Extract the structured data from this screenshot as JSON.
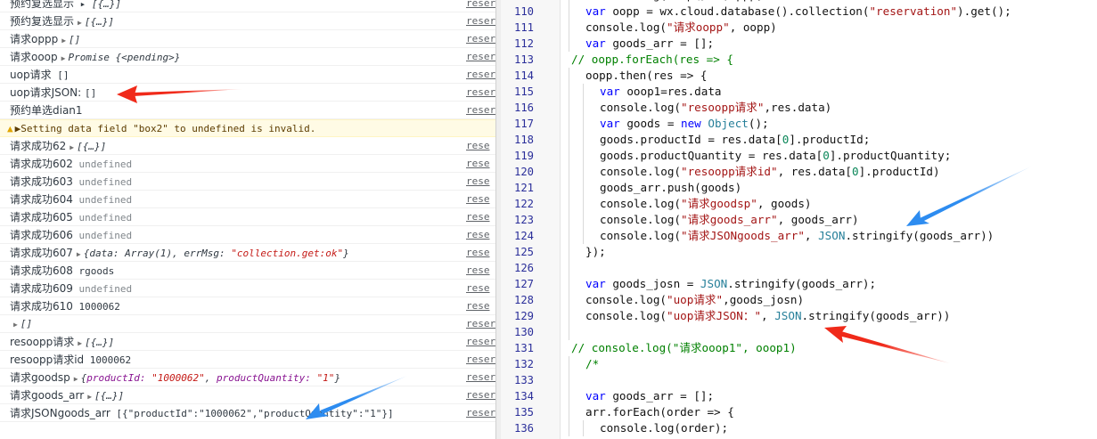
{
  "console": {
    "rows": [
      {
        "kind": "plain",
        "parts": [
          {
            "t": "cjk",
            "v": "预约复选显示"
          },
          {
            "t": "obj",
            "v": " ▸ [{…}]"
          }
        ],
        "src": "reser"
      },
      {
        "kind": "plain",
        "parts": [
          {
            "t": "cjk",
            "v": "预约复选显示"
          },
          {
            "t": "tri",
            "v": "▶"
          },
          {
            "t": "obj",
            "v": "[{…}]"
          }
        ],
        "src": "reser"
      },
      {
        "kind": "plain",
        "parts": [
          {
            "t": "cjk",
            "v": "请求oppp"
          },
          {
            "t": "tri",
            "v": "▶"
          },
          {
            "t": "obj",
            "v": "[]"
          }
        ],
        "src": "reserv"
      },
      {
        "kind": "plain",
        "parts": [
          {
            "t": "cjk",
            "v": "请求ooop"
          },
          {
            "t": "tri",
            "v": "▶"
          },
          {
            "t": "obj",
            "v": "Promise {<pending>}"
          }
        ],
        "src": "reserv"
      },
      {
        "kind": "plain",
        "parts": [
          {
            "t": "cjk",
            "v": "uop请求"
          },
          {
            "t": "txt",
            "v": " []"
          }
        ],
        "src": "reserv"
      },
      {
        "kind": "plain",
        "parts": [
          {
            "t": "cjk",
            "v": "uop请求JSON: "
          },
          {
            "t": "txt",
            "v": " []"
          }
        ],
        "src": "reserv"
      },
      {
        "kind": "plain",
        "parts": [
          {
            "t": "cjk",
            "v": "预约单选dian1"
          }
        ],
        "src": "reser"
      },
      {
        "kind": "warn",
        "parts": [
          {
            "t": "txt",
            "v": "▶Setting data field \"box2\" to undefined is invalid."
          }
        ],
        "src": ""
      },
      {
        "kind": "plain",
        "parts": [
          {
            "t": "cjk",
            "v": "请求成功62"
          },
          {
            "t": "tri",
            "v": "▶"
          },
          {
            "t": "obj",
            "v": "[{…}]"
          }
        ],
        "src": "rese"
      },
      {
        "kind": "plain",
        "parts": [
          {
            "t": "cjk",
            "v": "请求成功602"
          },
          {
            "t": "undef",
            "v": " undefined"
          }
        ],
        "src": "rese"
      },
      {
        "kind": "plain",
        "parts": [
          {
            "t": "cjk",
            "v": "请求成功603"
          },
          {
            "t": "undef",
            "v": " undefined"
          }
        ],
        "src": "rese"
      },
      {
        "kind": "plain",
        "parts": [
          {
            "t": "cjk",
            "v": "请求成功604"
          },
          {
            "t": "undef",
            "v": " undefined"
          }
        ],
        "src": "rese"
      },
      {
        "kind": "plain",
        "parts": [
          {
            "t": "cjk",
            "v": "请求成功605"
          },
          {
            "t": "undef",
            "v": " undefined"
          }
        ],
        "src": "rese"
      },
      {
        "kind": "plain",
        "parts": [
          {
            "t": "cjk",
            "v": "请求成功606"
          },
          {
            "t": "undef",
            "v": " undefined"
          }
        ],
        "src": "rese"
      },
      {
        "kind": "plain",
        "parts": [
          {
            "t": "cjk",
            "v": "请求成功607"
          },
          {
            "t": "tri",
            "v": "▶"
          },
          {
            "t": "obj",
            "v": "{data: Array(1), errMsg: "
          },
          {
            "t": "str",
            "v": "\"collection.get:ok\""
          },
          {
            "t": "obj",
            "v": "}"
          }
        ],
        "src": "rese"
      },
      {
        "kind": "plain",
        "parts": [
          {
            "t": "cjk",
            "v": "请求成功608"
          },
          {
            "t": "txt",
            "v": " rgoods"
          }
        ],
        "src": "rese"
      },
      {
        "kind": "plain",
        "parts": [
          {
            "t": "cjk",
            "v": "请求成功609"
          },
          {
            "t": "undef",
            "v": " undefined"
          }
        ],
        "src": "rese"
      },
      {
        "kind": "plain",
        "parts": [
          {
            "t": "cjk",
            "v": "请求成功610"
          },
          {
            "t": "txt",
            "v": " 1000062"
          }
        ],
        "src": "rese"
      },
      {
        "kind": "plain",
        "parts": [
          {
            "t": "tri",
            "v": "▶"
          },
          {
            "t": "obj",
            "v": "[]"
          }
        ],
        "src": "reser"
      },
      {
        "kind": "plain",
        "parts": [
          {
            "t": "cjk",
            "v": "resoopp请求"
          },
          {
            "t": "tri",
            "v": "▶"
          },
          {
            "t": "obj",
            "v": "[{…}]"
          }
        ],
        "src": "reser"
      },
      {
        "kind": "plain",
        "parts": [
          {
            "t": "cjk",
            "v": "resoopp请求id"
          },
          {
            "t": "txt",
            "v": " 1000062"
          }
        ],
        "src": "reser"
      },
      {
        "kind": "plain",
        "parts": [
          {
            "t": "cjk",
            "v": "请求goodsp"
          },
          {
            "t": "tri",
            "v": "▶"
          },
          {
            "t": "obj",
            "v": "{"
          },
          {
            "t": "key",
            "v": "productId: "
          },
          {
            "t": "str",
            "v": "\"1000062\""
          },
          {
            "t": "obj",
            "v": ", "
          },
          {
            "t": "key",
            "v": "productQuantity: "
          },
          {
            "t": "str",
            "v": "\"1\""
          },
          {
            "t": "obj",
            "v": "}"
          }
        ],
        "src": "reser"
      },
      {
        "kind": "plain",
        "parts": [
          {
            "t": "cjk",
            "v": "请求goods_arr"
          },
          {
            "t": "tri",
            "v": "▶"
          },
          {
            "t": "obj",
            "v": "[{…}]"
          }
        ],
        "src": "reser"
      },
      {
        "kind": "plain",
        "parts": [
          {
            "t": "cjk",
            "v": "请求JSONgoods_arr"
          },
          {
            "t": "txt",
            "v": " [{\"productId\":\"1000062\",\"productQuantity\":\"1\"}]"
          }
        ],
        "src": "reser"
      }
    ]
  },
  "editor": {
    "lines": [
      {
        "n": "",
        "indent": 1,
        "tokens": [
          {
            "c": "t-pl",
            "v": "console.log(\"uop请求\",oppp)"
          }
        ]
      },
      {
        "n": "110",
        "indent": 1,
        "tokens": [
          {
            "c": "t-kw",
            "v": "var "
          },
          {
            "c": "t-pl",
            "v": "oopp = wx.cloud.database().collection("
          },
          {
            "c": "t-str",
            "v": "\"reservation\""
          },
          {
            "c": "t-pl",
            "v": ").get();"
          }
        ]
      },
      {
        "n": "111",
        "indent": 1,
        "tokens": [
          {
            "c": "t-pl",
            "v": "console.log("
          },
          {
            "c": "t-str",
            "v": "\"请求oopp\""
          },
          {
            "c": "t-pl",
            "v": ", oopp)"
          }
        ]
      },
      {
        "n": "112",
        "indent": 1,
        "tokens": [
          {
            "c": "t-kw",
            "v": "var "
          },
          {
            "c": "t-pl",
            "v": "goods_arr = [];"
          }
        ]
      },
      {
        "n": "113",
        "indent": 0,
        "tokens": [
          {
            "c": "t-cm",
            "v": "// oopp.forEach(res => {"
          }
        ]
      },
      {
        "n": "114",
        "indent": 1,
        "tokens": [
          {
            "c": "t-pl",
            "v": "oopp.then(res => {"
          }
        ]
      },
      {
        "n": "115",
        "indent": 2,
        "tokens": [
          {
            "c": "t-kw",
            "v": "var "
          },
          {
            "c": "t-pl",
            "v": "ooop1=res.data"
          }
        ]
      },
      {
        "n": "116",
        "indent": 2,
        "tokens": [
          {
            "c": "t-pl",
            "v": "console.log("
          },
          {
            "c": "t-str",
            "v": "\"resoopp请求\""
          },
          {
            "c": "t-pl",
            "v": ",res.data)"
          }
        ]
      },
      {
        "n": "117",
        "indent": 2,
        "tokens": [
          {
            "c": "t-kw",
            "v": "var "
          },
          {
            "c": "t-pl",
            "v": "goods = "
          },
          {
            "c": "t-kw",
            "v": "new "
          },
          {
            "c": "t-ty",
            "v": "Object"
          },
          {
            "c": "t-pl",
            "v": "();"
          }
        ]
      },
      {
        "n": "118",
        "indent": 2,
        "tokens": [
          {
            "c": "t-pl",
            "v": "goods.productId = res.data["
          },
          {
            "c": "t-num",
            "v": "0"
          },
          {
            "c": "t-pl",
            "v": "].productId;"
          }
        ]
      },
      {
        "n": "119",
        "indent": 2,
        "tokens": [
          {
            "c": "t-pl",
            "v": "goods.productQuantity = res.data["
          },
          {
            "c": "t-num",
            "v": "0"
          },
          {
            "c": "t-pl",
            "v": "].productQuantity;"
          }
        ]
      },
      {
        "n": "120",
        "indent": 2,
        "tokens": [
          {
            "c": "t-pl",
            "v": "console.log("
          },
          {
            "c": "t-str",
            "v": "\"resoopp请求id\""
          },
          {
            "c": "t-pl",
            "v": ", res.data["
          },
          {
            "c": "t-num",
            "v": "0"
          },
          {
            "c": "t-pl",
            "v": "].productId)"
          }
        ]
      },
      {
        "n": "121",
        "indent": 2,
        "tokens": [
          {
            "c": "t-pl",
            "v": "goods_arr.push(goods)"
          }
        ]
      },
      {
        "n": "122",
        "indent": 2,
        "tokens": [
          {
            "c": "t-pl",
            "v": "console.log("
          },
          {
            "c": "t-str",
            "v": "\"请求goodsp\""
          },
          {
            "c": "t-pl",
            "v": ", goods)"
          }
        ]
      },
      {
        "n": "123",
        "indent": 2,
        "tokens": [
          {
            "c": "t-pl",
            "v": "console.log("
          },
          {
            "c": "t-str",
            "v": "\"请求goods_arr\""
          },
          {
            "c": "t-pl",
            "v": ", goods_arr)"
          }
        ]
      },
      {
        "n": "124",
        "indent": 2,
        "tokens": [
          {
            "c": "t-pl",
            "v": "console.log("
          },
          {
            "c": "t-str",
            "v": "\"请求JSONgoods_arr\""
          },
          {
            "c": "t-pl",
            "v": ", "
          },
          {
            "c": "t-ty",
            "v": "JSON"
          },
          {
            "c": "t-pl",
            "v": ".stringify(goods_arr))"
          }
        ]
      },
      {
        "n": "125",
        "indent": 1,
        "tokens": [
          {
            "c": "t-pl",
            "v": "});"
          }
        ]
      },
      {
        "n": "126",
        "indent": 1,
        "tokens": []
      },
      {
        "n": "127",
        "indent": 1,
        "tokens": [
          {
            "c": "t-kw",
            "v": "var "
          },
          {
            "c": "t-pl",
            "v": "goods_josn = "
          },
          {
            "c": "t-ty",
            "v": "JSON"
          },
          {
            "c": "t-pl",
            "v": ".stringify(goods_arr);"
          }
        ]
      },
      {
        "n": "128",
        "indent": 1,
        "tokens": [
          {
            "c": "t-pl",
            "v": "console.log("
          },
          {
            "c": "t-str",
            "v": "\"uop请求\""
          },
          {
            "c": "t-pl",
            "v": ",goods_josn)"
          }
        ]
      },
      {
        "n": "129",
        "indent": 1,
        "tokens": [
          {
            "c": "t-pl",
            "v": "console.log("
          },
          {
            "c": "t-str",
            "v": "\"uop请求JSON：\""
          },
          {
            "c": "t-pl",
            "v": ", "
          },
          {
            "c": "t-ty",
            "v": "JSON"
          },
          {
            "c": "t-pl",
            "v": ".stringify(goods_arr))"
          }
        ]
      },
      {
        "n": "130",
        "indent": 1,
        "tokens": []
      },
      {
        "n": "131",
        "indent": 0,
        "tokens": [
          {
            "c": "t-cm",
            "v": "// console.log(\"请求ooop1\", ooop1)"
          }
        ]
      },
      {
        "n": "132",
        "indent": 1,
        "tokens": [
          {
            "c": "t-cm",
            "v": "/*"
          }
        ]
      },
      {
        "n": "133",
        "indent": 1,
        "tokens": []
      },
      {
        "n": "134",
        "indent": 1,
        "tokens": [
          {
            "c": "t-kw",
            "v": "var "
          },
          {
            "c": "t-pl",
            "v": "goods_arr = [];"
          }
        ]
      },
      {
        "n": "135",
        "indent": 1,
        "tokens": [
          {
            "c": "t-pl",
            "v": "arr.forEach(order => {"
          }
        ]
      },
      {
        "n": "136",
        "indent": 2,
        "tokens": [
          {
            "c": "t-pl",
            "v": "console.log(order);"
          }
        ]
      }
    ]
  },
  "colors": {
    "arrow_red": "#f02a1a",
    "arrow_blue": "#2d8cf0"
  }
}
